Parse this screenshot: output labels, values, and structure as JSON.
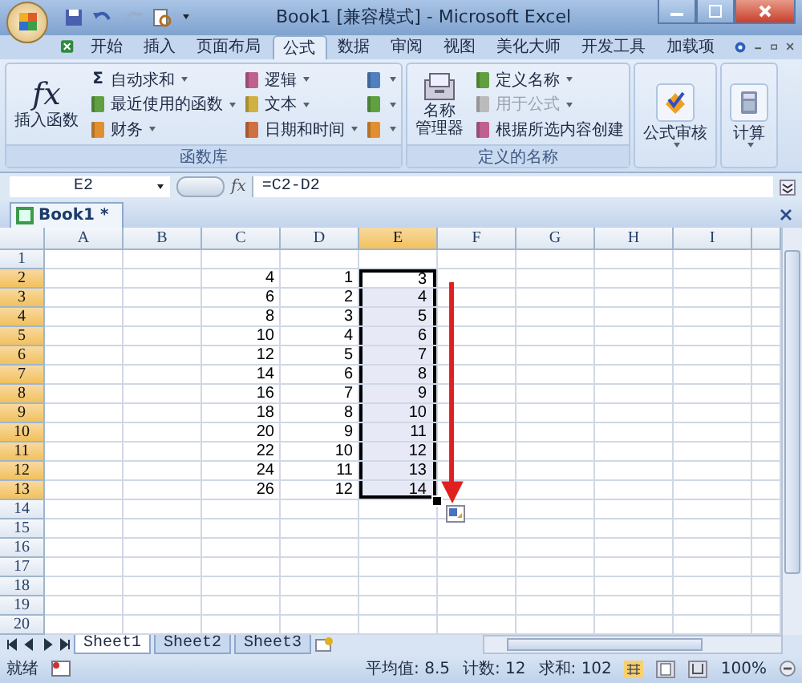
{
  "window": {
    "title": "Book1  [兼容模式] - Microsoft Excel"
  },
  "tabs": [
    {
      "label": "开始",
      "selected": false
    },
    {
      "label": "插入",
      "selected": false
    },
    {
      "label": "页面布局",
      "selected": false
    },
    {
      "label": "公式",
      "selected": true
    },
    {
      "label": "数据",
      "selected": false
    },
    {
      "label": "审阅",
      "selected": false
    },
    {
      "label": "视图",
      "selected": false
    },
    {
      "label": "美化大师",
      "selected": false
    },
    {
      "label": "开发工具",
      "selected": false
    },
    {
      "label": "加载项",
      "selected": false
    }
  ],
  "ribbon": {
    "groups": [
      {
        "label": "函数库",
        "columns": [
          [
            {
              "kind": "large",
              "label": "插入函数",
              "icon_text": "fx"
            }
          ],
          [
            {
              "kind": "small",
              "label": "自动求和",
              "icon_text": "Σ",
              "dropdown": true
            },
            {
              "kind": "small",
              "label": "最近使用的函数",
              "dropdown": true
            },
            {
              "kind": "small",
              "label": "财务",
              "dropdown": true
            }
          ],
          [
            {
              "kind": "small",
              "label": "逻辑",
              "dropdown": true
            },
            {
              "kind": "small",
              "label": "文本",
              "dropdown": true
            },
            {
              "kind": "small",
              "label": "日期和时间",
              "dropdown": true
            }
          ],
          [
            {
              "kind": "icon",
              "dropdown": true
            },
            {
              "kind": "icon",
              "dropdown": true
            },
            {
              "kind": "icon",
              "dropdown": true
            }
          ]
        ]
      },
      {
        "label": "定义的名称",
        "columns": [
          [
            {
              "kind": "large",
              "label_lines": [
                "名称",
                "管理器"
              ]
            }
          ],
          [
            {
              "kind": "small",
              "label": "定义名称",
              "dropdown": true,
              "disabled": false
            },
            {
              "kind": "small",
              "label": "用于公式",
              "dropdown": true,
              "disabled": true
            },
            {
              "kind": "small",
              "label": "根据所选内容创建",
              "disabled": false
            }
          ]
        ]
      },
      {
        "columns": [
          [
            {
              "kind": "large",
              "label": "公式审核",
              "dropdown": true
            }
          ]
        ]
      },
      {
        "columns": [
          [
            {
              "kind": "large",
              "label": "计算",
              "dropdown": true
            }
          ]
        ]
      }
    ]
  },
  "formula_bar": {
    "name_box": "E2",
    "fx": "fx",
    "formula": "=C2-D2"
  },
  "workbook_tab": {
    "label": "Book1 *"
  },
  "columns": [
    {
      "label": "A",
      "selected": false
    },
    {
      "label": "B",
      "selected": false
    },
    {
      "label": "C",
      "selected": false
    },
    {
      "label": "D",
      "selected": false
    },
    {
      "label": "E",
      "selected": true
    },
    {
      "label": "F",
      "selected": false
    },
    {
      "label": "G",
      "selected": false
    },
    {
      "label": "H",
      "selected": false
    },
    {
      "label": "I",
      "selected": false
    }
  ],
  "rows": [
    {
      "label": "1",
      "selected": false
    },
    {
      "label": "2",
      "selected": true,
      "cells": [
        {},
        {},
        {
          "text": "4"
        },
        {
          "text": "1"
        },
        {
          "text": "3"
        }
      ]
    },
    {
      "label": "3",
      "selected": true,
      "cells": [
        {},
        {},
        {
          "text": "6"
        },
        {
          "text": "2"
        },
        {
          "text": "4"
        }
      ]
    },
    {
      "label": "4",
      "selected": true,
      "cells": [
        {},
        {},
        {
          "text": "8"
        },
        {
          "text": "3"
        },
        {
          "text": "5"
        }
      ]
    },
    {
      "label": "5",
      "selected": true,
      "cells": [
        {},
        {},
        {
          "text": "10"
        },
        {
          "text": "4"
        },
        {
          "text": "6"
        }
      ]
    },
    {
      "label": "6",
      "selected": true,
      "cells": [
        {},
        {},
        {
          "text": "12"
        },
        {
          "text": "5"
        },
        {
          "text": "7"
        }
      ]
    },
    {
      "label": "7",
      "selected": true,
      "cells": [
        {},
        {},
        {
          "text": "14"
        },
        {
          "text": "6"
        },
        {
          "text": "8"
        }
      ]
    },
    {
      "label": "8",
      "selected": true,
      "cells": [
        {},
        {},
        {
          "text": "16"
        },
        {
          "text": "7"
        },
        {
          "text": "9"
        }
      ]
    },
    {
      "label": "9",
      "selected": true,
      "cells": [
        {},
        {},
        {
          "text": "18"
        },
        {
          "text": "8"
        },
        {
          "text": "10"
        }
      ]
    },
    {
      "label": "10",
      "selected": true,
      "cells": [
        {},
        {},
        {
          "text": "20"
        },
        {
          "text": "9"
        },
        {
          "text": "11"
        }
      ]
    },
    {
      "label": "11",
      "selected": true,
      "cells": [
        {},
        {},
        {
          "text": "22"
        },
        {
          "text": "10"
        },
        {
          "text": "12"
        }
      ]
    },
    {
      "label": "12",
      "selected": true,
      "cells": [
        {},
        {},
        {
          "text": "24"
        },
        {
          "text": "11"
        },
        {
          "text": "13"
        }
      ]
    },
    {
      "label": "13",
      "selected": true,
      "cells": [
        {},
        {},
        {
          "text": "26"
        },
        {
          "text": "12"
        },
        {
          "text": "14"
        }
      ]
    },
    {
      "label": "14",
      "selected": false
    },
    {
      "label": "15",
      "selected": false
    },
    {
      "label": "16",
      "selected": false
    },
    {
      "label": "17",
      "selected": false
    },
    {
      "label": "18",
      "selected": false
    },
    {
      "label": "19",
      "selected": false
    },
    {
      "label": "20",
      "selected": false
    }
  ],
  "sheet_tabs": [
    {
      "label": "Sheet1",
      "selected": true
    },
    {
      "label": "Sheet2",
      "selected": false
    },
    {
      "label": "Sheet3",
      "selected": false
    }
  ],
  "status_bar": {
    "status": "就绪",
    "average": "平均值: 8.5",
    "count": "计数: 12",
    "sum": "求和: 102",
    "zoom": "100%"
  }
}
